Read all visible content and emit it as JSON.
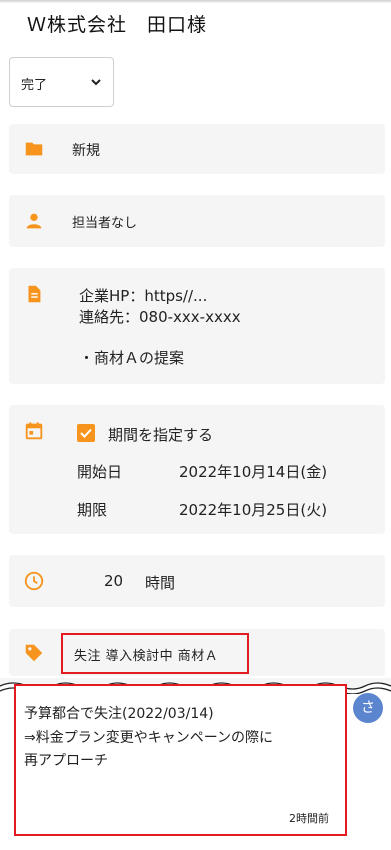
{
  "header": {
    "title": "Ｗ株式会社　田口様"
  },
  "status": {
    "value": "完了"
  },
  "category": {
    "label": "新規"
  },
  "assignee": {
    "label": "担当者なし"
  },
  "notes": {
    "line1": "企業HP：https//...",
    "line2": "連絡先：080-xxx-xxxx",
    "line3": "・商材Ａの提案"
  },
  "period": {
    "checkbox_label": "期間を指定する",
    "checked": true,
    "start_label": "開始日",
    "start_value": "2022年10月14日(金)",
    "due_label": "期限",
    "due_value": "2022年10月25日(火)"
  },
  "hours": {
    "value": "20",
    "unit": "時間"
  },
  "tags": {
    "text": "失注  導入検討中  商材Ａ"
  },
  "comment": {
    "line1": "予算都合で失注(2022/03/14)",
    "line2": "⇒料金プラン変更やキャンペーンの際に",
    "line3": "再アプローチ",
    "avatar_initial": "さ",
    "time_ago": "2時間前"
  },
  "colors": {
    "accent": "#f7941d",
    "highlight": "#e21b23",
    "avatar": "#5b86cf",
    "card_bg": "#f5f5f5"
  }
}
